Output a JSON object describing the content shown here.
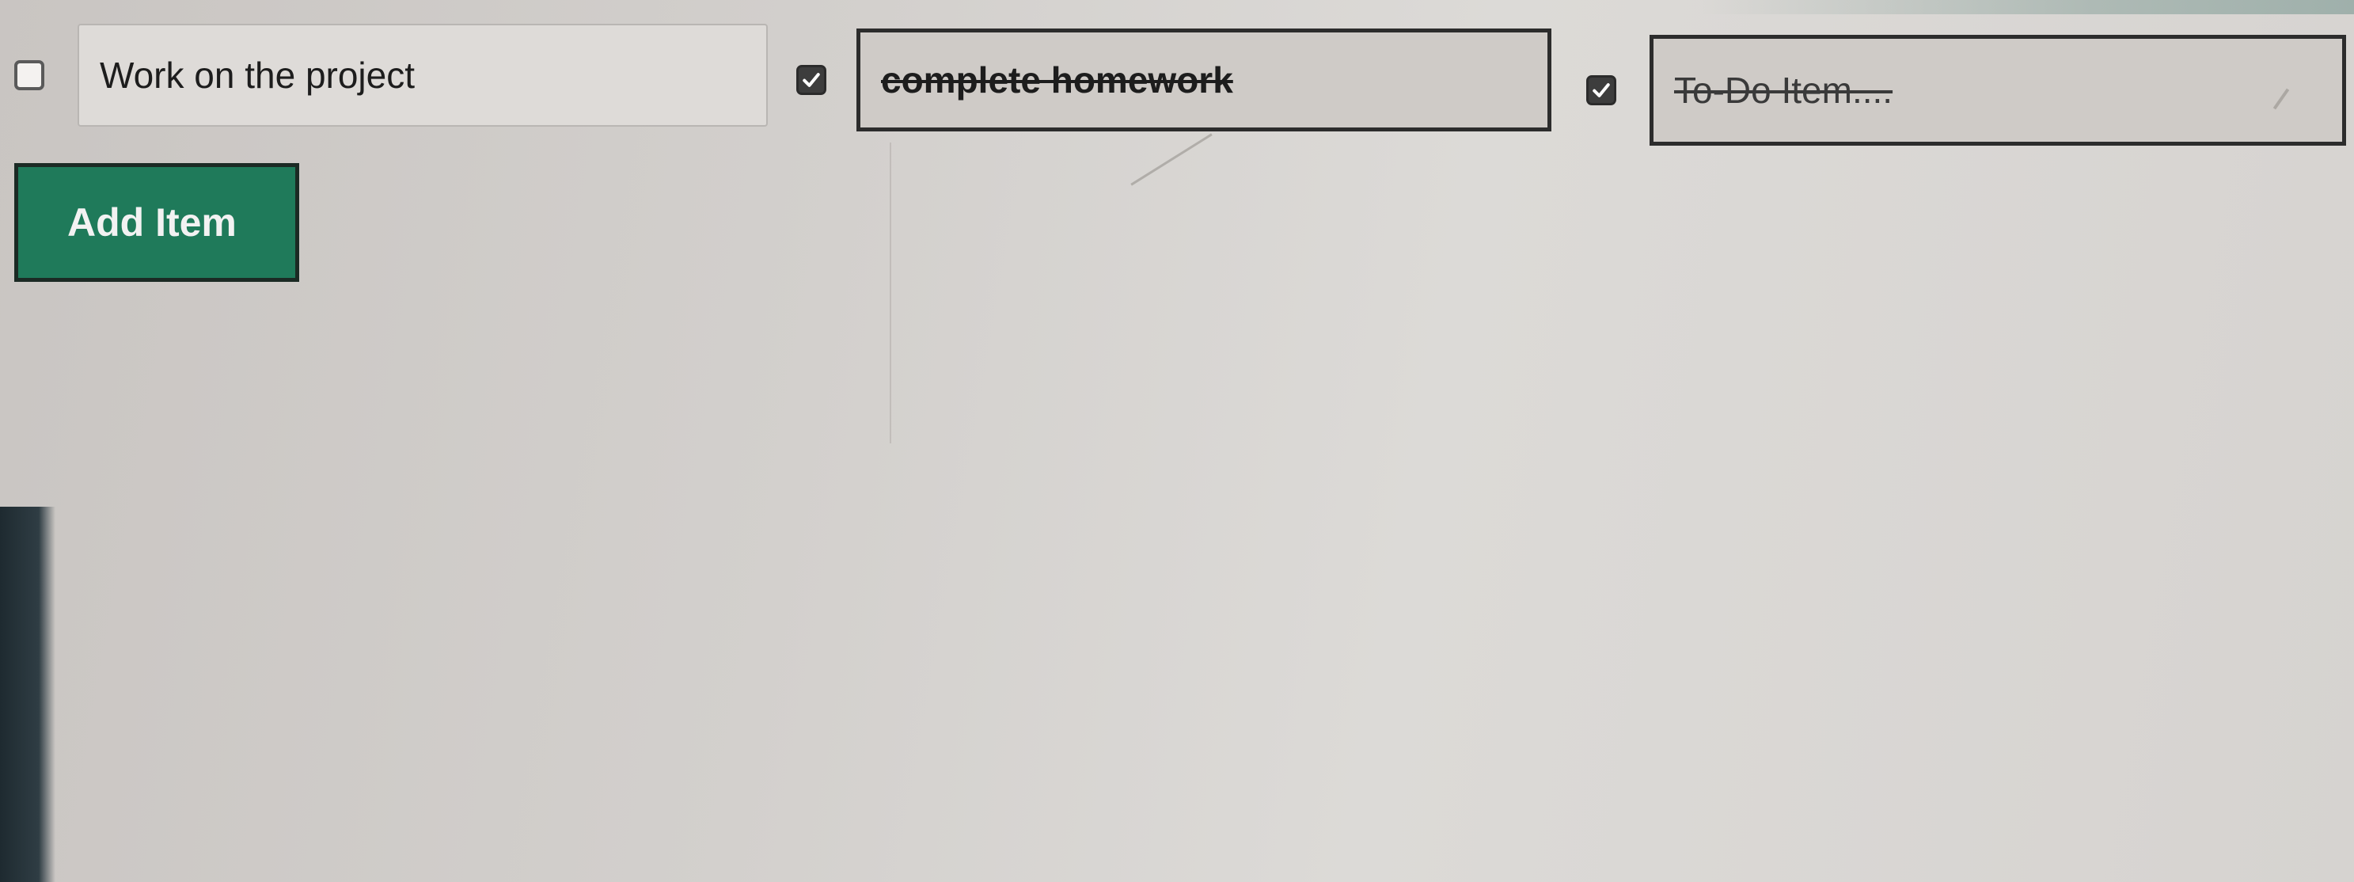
{
  "todo_items": [
    {
      "text": "Work on the  project",
      "completed": false
    },
    {
      "text": "complete homework",
      "completed": true
    },
    {
      "text": "To-Do Item....",
      "completed": true
    }
  ],
  "add_button": {
    "label": "Add Item"
  },
  "colors": {
    "button_bg": "#1f7a5a",
    "checkbox_checked": "#3d3d3d",
    "background": "#d5d2cf"
  },
  "icons": {
    "checkbox_checked": "checkmark-icon"
  }
}
